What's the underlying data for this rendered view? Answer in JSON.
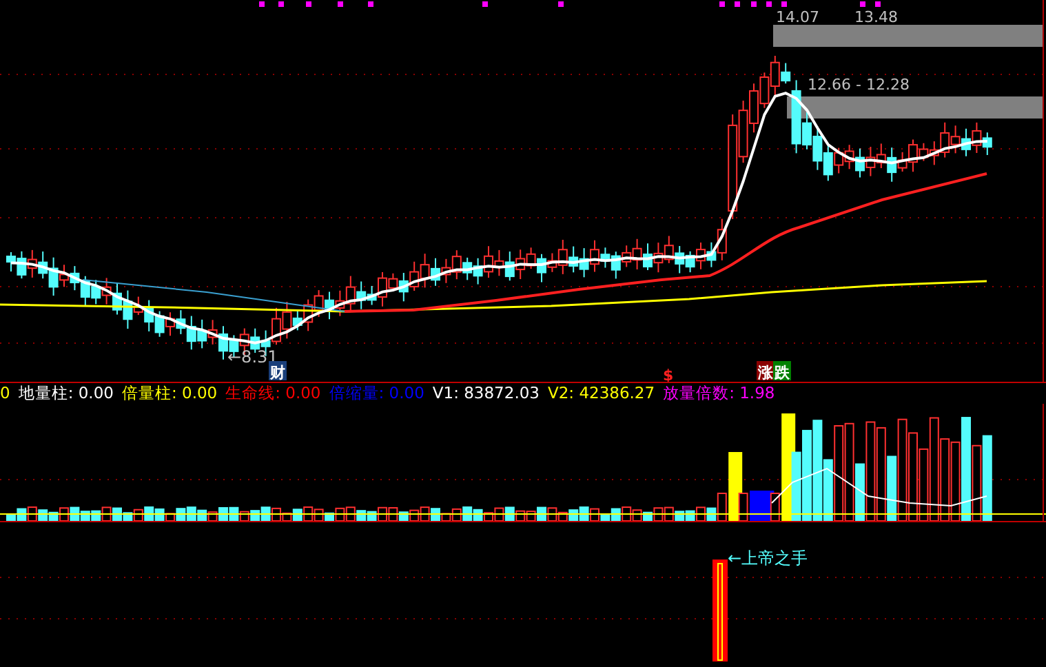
{
  "price_panel": {
    "high_labels": [
      "14.07",
      "13.48"
    ],
    "range_label": "12.66 - 12.28",
    "low_label": "←8.31",
    "markers": [
      {
        "text": "财",
        "kind": "finance"
      },
      {
        "text": "$",
        "kind": "dollar"
      },
      {
        "text": "涨",
        "kind": "rise"
      },
      {
        "text": "跌",
        "kind": "fall"
      }
    ]
  },
  "indicator_panel": {
    "cut_value": "0",
    "legend": [
      {
        "label": "地量柱: 0.00",
        "color": "#ffffff"
      },
      {
        "label": "倍量柱: 0.00",
        "color": "#ffff00"
      },
      {
        "label": "生命线: 0.00",
        "color": "#ff0000"
      },
      {
        "label": "倍缩量: 0.00",
        "color": "#0000ff"
      },
      {
        "label": "V1: 83872.03",
        "color": "#ffffff"
      },
      {
        "label": "V2: 42386.27",
        "color": "#ffff00"
      },
      {
        "label": "放量倍数: 1.98",
        "color": "#ff00ff"
      }
    ]
  },
  "signal_panel": {
    "label": "←上帝之手"
  }
}
